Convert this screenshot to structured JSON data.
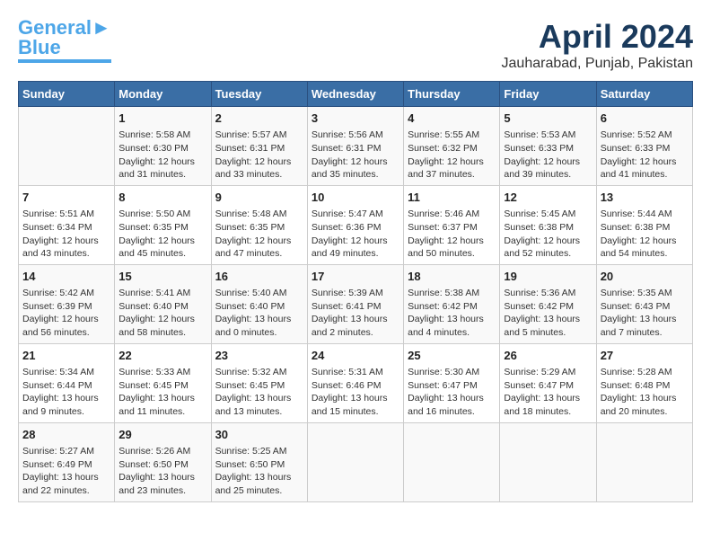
{
  "logo": {
    "line1": "General",
    "line2": "Blue"
  },
  "title": "April 2024",
  "subtitle": "Jauharabad, Punjab, Pakistan",
  "days_of_week": [
    "Sunday",
    "Monday",
    "Tuesday",
    "Wednesday",
    "Thursday",
    "Friday",
    "Saturday"
  ],
  "weeks": [
    [
      {
        "day": "",
        "content": ""
      },
      {
        "day": "1",
        "content": "Sunrise: 5:58 AM\nSunset: 6:30 PM\nDaylight: 12 hours\nand 31 minutes."
      },
      {
        "day": "2",
        "content": "Sunrise: 5:57 AM\nSunset: 6:31 PM\nDaylight: 12 hours\nand 33 minutes."
      },
      {
        "day": "3",
        "content": "Sunrise: 5:56 AM\nSunset: 6:31 PM\nDaylight: 12 hours\nand 35 minutes."
      },
      {
        "day": "4",
        "content": "Sunrise: 5:55 AM\nSunset: 6:32 PM\nDaylight: 12 hours\nand 37 minutes."
      },
      {
        "day": "5",
        "content": "Sunrise: 5:53 AM\nSunset: 6:33 PM\nDaylight: 12 hours\nand 39 minutes."
      },
      {
        "day": "6",
        "content": "Sunrise: 5:52 AM\nSunset: 6:33 PM\nDaylight: 12 hours\nand 41 minutes."
      }
    ],
    [
      {
        "day": "7",
        "content": "Sunrise: 5:51 AM\nSunset: 6:34 PM\nDaylight: 12 hours\nand 43 minutes."
      },
      {
        "day": "8",
        "content": "Sunrise: 5:50 AM\nSunset: 6:35 PM\nDaylight: 12 hours\nand 45 minutes."
      },
      {
        "day": "9",
        "content": "Sunrise: 5:48 AM\nSunset: 6:35 PM\nDaylight: 12 hours\nand 47 minutes."
      },
      {
        "day": "10",
        "content": "Sunrise: 5:47 AM\nSunset: 6:36 PM\nDaylight: 12 hours\nand 49 minutes."
      },
      {
        "day": "11",
        "content": "Sunrise: 5:46 AM\nSunset: 6:37 PM\nDaylight: 12 hours\nand 50 minutes."
      },
      {
        "day": "12",
        "content": "Sunrise: 5:45 AM\nSunset: 6:38 PM\nDaylight: 12 hours\nand 52 minutes."
      },
      {
        "day": "13",
        "content": "Sunrise: 5:44 AM\nSunset: 6:38 PM\nDaylight: 12 hours\nand 54 minutes."
      }
    ],
    [
      {
        "day": "14",
        "content": "Sunrise: 5:42 AM\nSunset: 6:39 PM\nDaylight: 12 hours\nand 56 minutes."
      },
      {
        "day": "15",
        "content": "Sunrise: 5:41 AM\nSunset: 6:40 PM\nDaylight: 12 hours\nand 58 minutes."
      },
      {
        "day": "16",
        "content": "Sunrise: 5:40 AM\nSunset: 6:40 PM\nDaylight: 13 hours\nand 0 minutes."
      },
      {
        "day": "17",
        "content": "Sunrise: 5:39 AM\nSunset: 6:41 PM\nDaylight: 13 hours\nand 2 minutes."
      },
      {
        "day": "18",
        "content": "Sunrise: 5:38 AM\nSunset: 6:42 PM\nDaylight: 13 hours\nand 4 minutes."
      },
      {
        "day": "19",
        "content": "Sunrise: 5:36 AM\nSunset: 6:42 PM\nDaylight: 13 hours\nand 5 minutes."
      },
      {
        "day": "20",
        "content": "Sunrise: 5:35 AM\nSunset: 6:43 PM\nDaylight: 13 hours\nand 7 minutes."
      }
    ],
    [
      {
        "day": "21",
        "content": "Sunrise: 5:34 AM\nSunset: 6:44 PM\nDaylight: 13 hours\nand 9 minutes."
      },
      {
        "day": "22",
        "content": "Sunrise: 5:33 AM\nSunset: 6:45 PM\nDaylight: 13 hours\nand 11 minutes."
      },
      {
        "day": "23",
        "content": "Sunrise: 5:32 AM\nSunset: 6:45 PM\nDaylight: 13 hours\nand 13 minutes."
      },
      {
        "day": "24",
        "content": "Sunrise: 5:31 AM\nSunset: 6:46 PM\nDaylight: 13 hours\nand 15 minutes."
      },
      {
        "day": "25",
        "content": "Sunrise: 5:30 AM\nSunset: 6:47 PM\nDaylight: 13 hours\nand 16 minutes."
      },
      {
        "day": "26",
        "content": "Sunrise: 5:29 AM\nSunset: 6:47 PM\nDaylight: 13 hours\nand 18 minutes."
      },
      {
        "day": "27",
        "content": "Sunrise: 5:28 AM\nSunset: 6:48 PM\nDaylight: 13 hours\nand 20 minutes."
      }
    ],
    [
      {
        "day": "28",
        "content": "Sunrise: 5:27 AM\nSunset: 6:49 PM\nDaylight: 13 hours\nand 22 minutes."
      },
      {
        "day": "29",
        "content": "Sunrise: 5:26 AM\nSunset: 6:50 PM\nDaylight: 13 hours\nand 23 minutes."
      },
      {
        "day": "30",
        "content": "Sunrise: 5:25 AM\nSunset: 6:50 PM\nDaylight: 13 hours\nand 25 minutes."
      },
      {
        "day": "",
        "content": ""
      },
      {
        "day": "",
        "content": ""
      },
      {
        "day": "",
        "content": ""
      },
      {
        "day": "",
        "content": ""
      }
    ]
  ]
}
